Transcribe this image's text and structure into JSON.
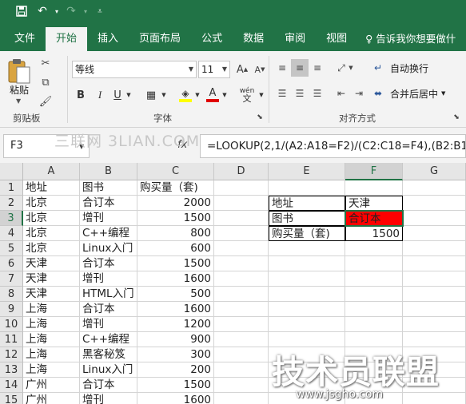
{
  "quick_access": {
    "save_icon": "save-icon",
    "undo_icon": "undo-icon",
    "redo_icon": "redo-icon",
    "customize_icon": "customize-qat-icon"
  },
  "tabs": [
    {
      "label": "文件",
      "active": false
    },
    {
      "label": "开始",
      "active": true
    },
    {
      "label": "插入",
      "active": false
    },
    {
      "label": "页面布局",
      "active": false
    },
    {
      "label": "公式",
      "active": false
    },
    {
      "label": "数据",
      "active": false
    },
    {
      "label": "审阅",
      "active": false
    },
    {
      "label": "视图",
      "active": false
    }
  ],
  "tell_me": "告诉我你想要做什",
  "ribbon": {
    "clipboard": {
      "paste_label": "粘贴",
      "group_label": "剪贴板"
    },
    "font": {
      "font_name": "等线",
      "font_size": "11",
      "group_label": "字体",
      "bold": "B",
      "italic": "I",
      "underline": "U",
      "font_color_letter": "A",
      "wen": "wén",
      "fill_color": "#ffff00",
      "text_color": "#e00000"
    },
    "alignment": {
      "wrap_text": "自动换行",
      "merge_center": "合并后居中",
      "group_label": "对齐方式"
    }
  },
  "formula_bar": {
    "name_box": "F3",
    "fx": "fx",
    "formula": "=LOOKUP(2,1/(A2:A18=F2)/(C2:C18=F4),(B2:B18))"
  },
  "watermark_top": "三联网 3LIAN.COM",
  "columns": [
    "A",
    "B",
    "C",
    "D",
    "E",
    "F",
    "G"
  ],
  "rows": [
    "1",
    "2",
    "3",
    "4",
    "5",
    "6",
    "7",
    "8",
    "9",
    "10",
    "11",
    "12",
    "13",
    "14",
    "15"
  ],
  "table": {
    "rows": [
      [
        "地址",
        "图书",
        "购买量（套)"
      ],
      [
        "北京",
        "合订本",
        "2000"
      ],
      [
        "北京",
        "增刊",
        "1500"
      ],
      [
        "北京",
        "C++编程",
        "800"
      ],
      [
        "北京",
        "Linux入门",
        "600"
      ],
      [
        "天津",
        "合订本",
        "1500"
      ],
      [
        "天津",
        "增刊",
        "1600"
      ],
      [
        "天津",
        "HTML入门",
        "500"
      ],
      [
        "上海",
        "合订本",
        "1600"
      ],
      [
        "上海",
        "增刊",
        "1200"
      ],
      [
        "上海",
        "C++编程",
        "900"
      ],
      [
        "上海",
        "黑客秘笈",
        "300"
      ],
      [
        "上海",
        "Linux入门",
        "200"
      ],
      [
        "广州",
        "合订本",
        "1500"
      ],
      [
        "广州",
        "增刊",
        "1600"
      ]
    ]
  },
  "lookup": {
    "rows": [
      [
        "地址",
        "天津"
      ],
      [
        "图书",
        "合订本"
      ],
      [
        "购买量（套)",
        "1500"
      ]
    ],
    "result_fill": "#ff0000"
  },
  "watermark_bottom": {
    "big": "技术员联盟",
    "url": "www.jsgho.com"
  }
}
